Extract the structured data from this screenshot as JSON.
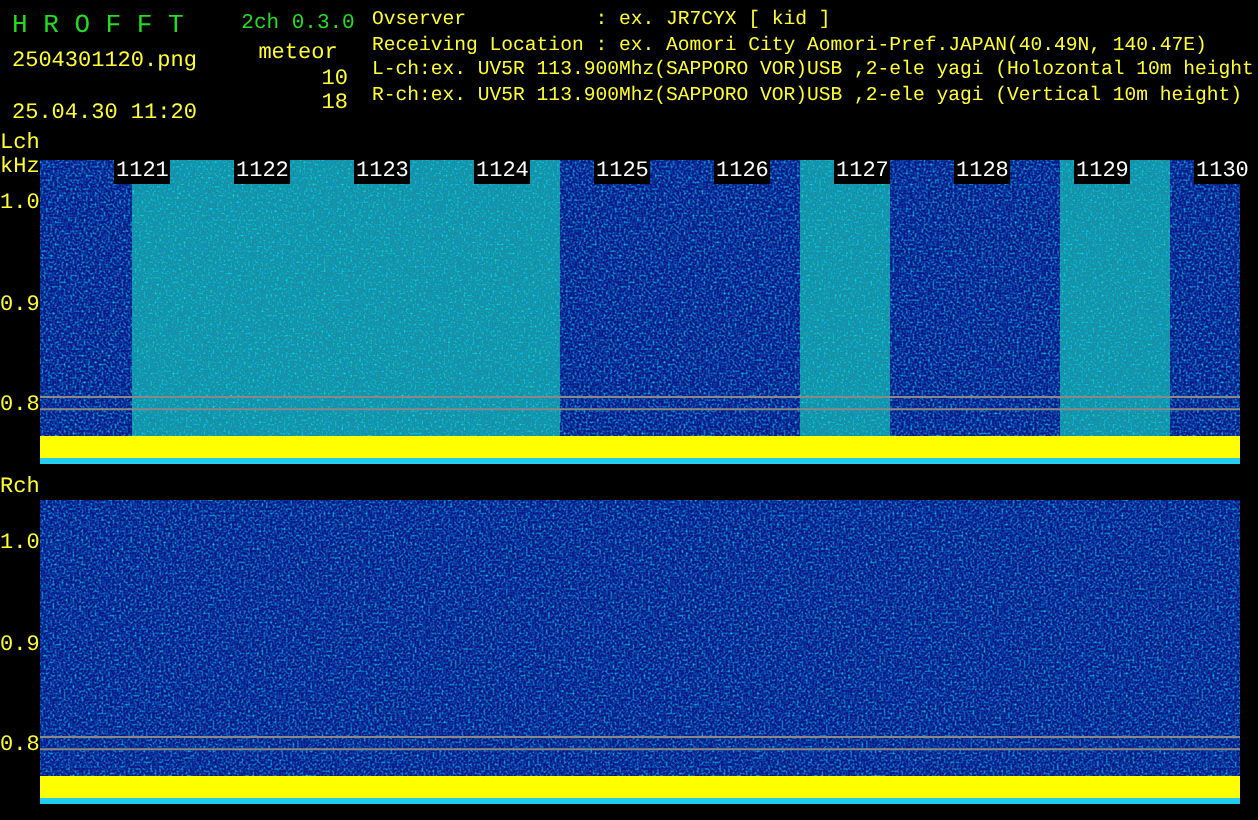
{
  "header": {
    "app_title": "H R O F F T",
    "version": "2ch 0.3.0",
    "filename": "2504301120.png",
    "datetime": "25.04.30 11:20",
    "meteor_label": "meteor",
    "meteor_counts": [
      "10",
      "18"
    ],
    "info": [
      {
        "label": "Ovserver           ",
        "value": ": ex. JR7CYX [ kid ]"
      },
      {
        "label": "Receiving Location ",
        "value": ": ex. Aomori City Aomori-Pref.JAPAN(40.49N, 140.47E)"
      },
      {
        "label": "L-ch:",
        "value": "ex. UV5R 113.900Mhz(SAPPORO VOR)USB ,2-ele yagi (Holozontal 10m height"
      },
      {
        "label": "R-ch:",
        "value": "ex. UV5R 113.900Mhz(SAPPORO VOR)USB ,2-ele yagi (Vertical 10m height)"
      }
    ]
  },
  "panels": [
    {
      "channel": "Lch",
      "unit": "kHz",
      "time_labels": [
        "1121",
        "1122",
        "1123",
        "1124",
        "1125",
        "1126",
        "1127",
        "1128",
        "1129",
        "1130"
      ],
      "yticks": [
        "1.0",
        "0.9",
        "0.8"
      ]
    },
    {
      "channel": "Rch",
      "yticks": [
        "1.0",
        "0.9",
        "0.8"
      ]
    }
  ]
}
